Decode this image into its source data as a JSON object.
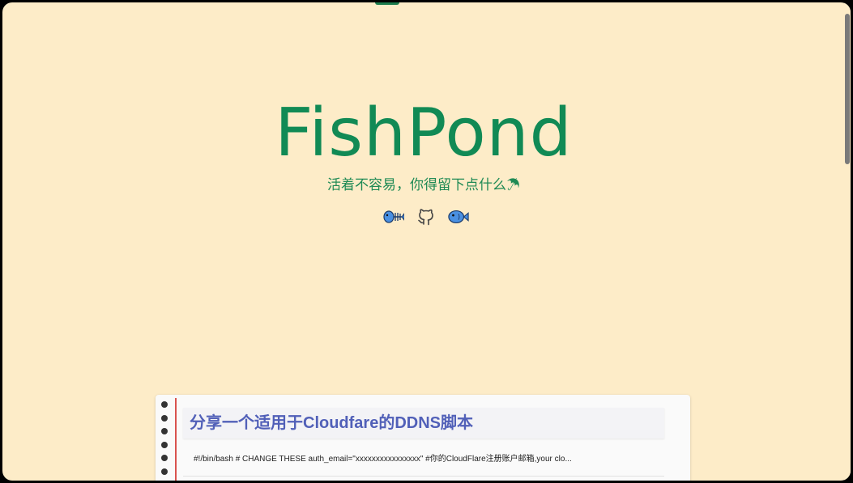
{
  "site": {
    "title": "FishPond",
    "tagline": "活着不容易，你得留下点什么☂"
  },
  "social": [
    {
      "icon": "fish-bone-icon"
    },
    {
      "icon": "github-icon"
    },
    {
      "icon": "blue-fish-icon"
    }
  ],
  "post": {
    "title": "分享一个适用于Cloudfare的DDNS脚本",
    "excerpt": "#!/bin/bash # CHANGE THESE auth_email=\"xxxxxxxxxxxxxxxx\" #你的CloudFlare注册账户邮箱,your clo..."
  },
  "colors": {
    "background": "#fdecc8",
    "title_green": "#118a55",
    "post_title_blue": "#5160b8",
    "margin_red": "#d9534f",
    "icon_blue": "#4a90e2"
  }
}
